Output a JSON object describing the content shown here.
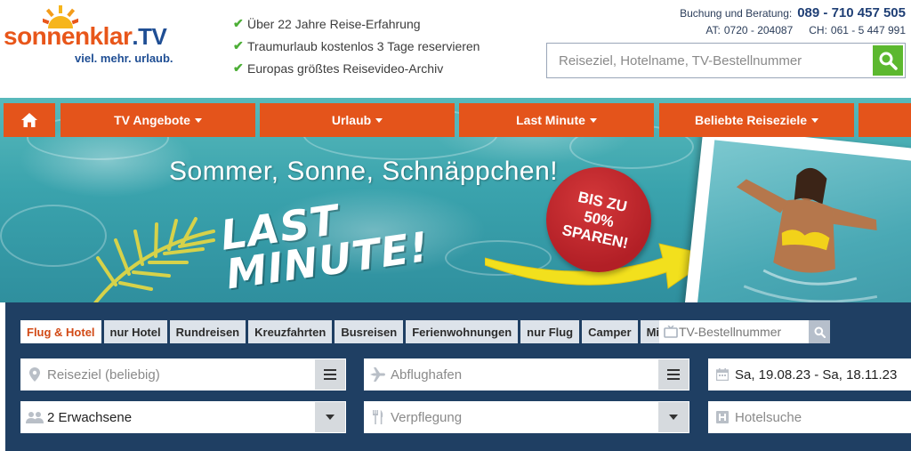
{
  "logo": {
    "brand": "sonnenklar",
    "brand_suffix": ".TV",
    "claim": "viel. mehr. urlaub."
  },
  "usps": [
    "Über 22 Jahre Reise-Erfahrung",
    "Traumurlaub kostenlos 3 Tage reservieren",
    "Europas größtes Reisevideo-Archiv"
  ],
  "contact": {
    "label": "Buchung und Beratung:",
    "phone": "089 - 710 457 505",
    "at_label": "AT:",
    "at_number": "0720 - 204087",
    "ch_label": "CH:",
    "ch_number": "061 - 5 447 991"
  },
  "top_search": {
    "placeholder": "Reiseziel, Hotelname, TV-Bestellnummer"
  },
  "nav": {
    "items": [
      {
        "label": "TV Angebote"
      },
      {
        "label": "Urlaub"
      },
      {
        "label": "Last Minute"
      },
      {
        "label": "Beliebte Reiseziele"
      }
    ]
  },
  "hero": {
    "slogan": "Sommer, Sonne, Schnäppchen!",
    "headline_1": "LAST",
    "headline_2": "MINUTE!",
    "badge_1": "BIS ZU",
    "badge_2": "50%",
    "badge_3": "SPAREN!"
  },
  "search_panel": {
    "tabs": [
      {
        "label": "Flug & Hotel",
        "active": true
      },
      {
        "label": "nur Hotel"
      },
      {
        "label": "Rundreisen"
      },
      {
        "label": "Kreuzfahrten"
      },
      {
        "label": "Busreisen"
      },
      {
        "label": "Ferienwohnungen"
      },
      {
        "label": "nur Flug"
      },
      {
        "label": "Camper"
      },
      {
        "label": "Mietwagen"
      }
    ],
    "tv_search_placeholder": "TV-Bestellnummer",
    "destination_placeholder": "Reiseziel (beliebig)",
    "airport_placeholder": "Abflughafen",
    "date_value": "Sa, 19.08.23 - Sa, 18.11.23",
    "travellers_value": "2 Erwachsene",
    "board_placeholder": "Verpflegung",
    "hotel_placeholder": "Hotelsuche"
  },
  "colors": {
    "brand_orange": "#e4541b",
    "brand_blue": "#1f4e94",
    "panel_blue": "#1f3f63",
    "search_green": "#5cb82f",
    "check_green": "#4cae36"
  }
}
